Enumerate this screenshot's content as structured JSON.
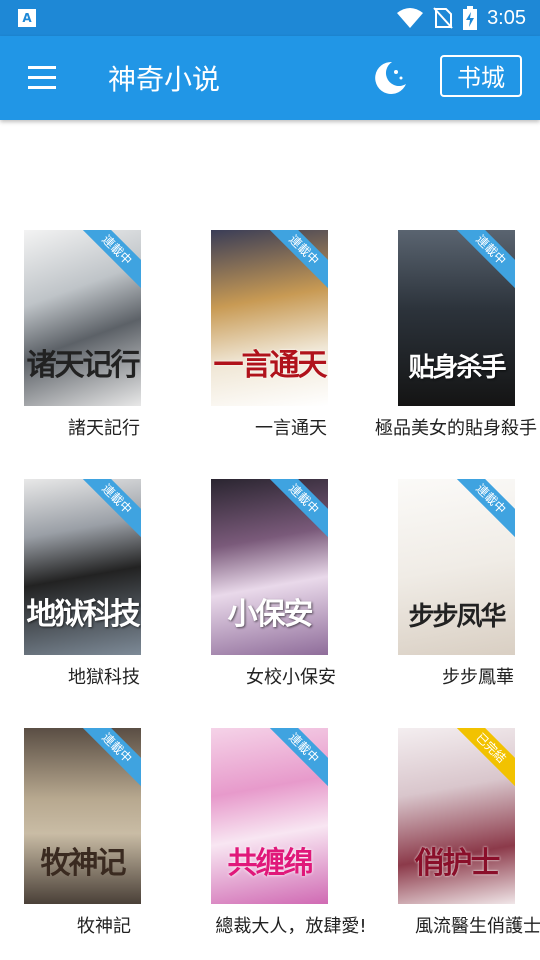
{
  "status_bar": {
    "time": "3:05",
    "app_indicator": "A"
  },
  "app_bar": {
    "title": "神奇小说",
    "store_button": "书城"
  },
  "books": [
    {
      "name": "諸天記行",
      "cover_title": "诸天记行",
      "status": "連載中"
    },
    {
      "name": "一言通天",
      "cover_title": "一言通天",
      "status": "連載中"
    },
    {
      "name": "極品美女的貼身殺手",
      "cover_title": "贴身杀手",
      "status": "連載中"
    },
    {
      "name": "地獄科技",
      "cover_title": "地狱科技",
      "status": "連載中"
    },
    {
      "name": "女校小保安",
      "cover_title": "小保安",
      "status": "連載中"
    },
    {
      "name": "步步鳳華",
      "cover_title": "步步凤华",
      "status": "連載中"
    },
    {
      "name": "牧神記",
      "cover_title": "牧神记",
      "status": "連載中"
    },
    {
      "name": "總裁大人，放肆愛!",
      "cover_title": "共缠绵",
      "status": "連載中"
    },
    {
      "name": "風流醫生俏護士",
      "cover_title": "俏护士",
      "status": "已完結"
    }
  ],
  "colors": {
    "status_bar": "#1e88d6",
    "app_bar": "#2196e6",
    "ribbon_serial": "#3fa3e0",
    "ribbon_done": "#f2c200"
  }
}
